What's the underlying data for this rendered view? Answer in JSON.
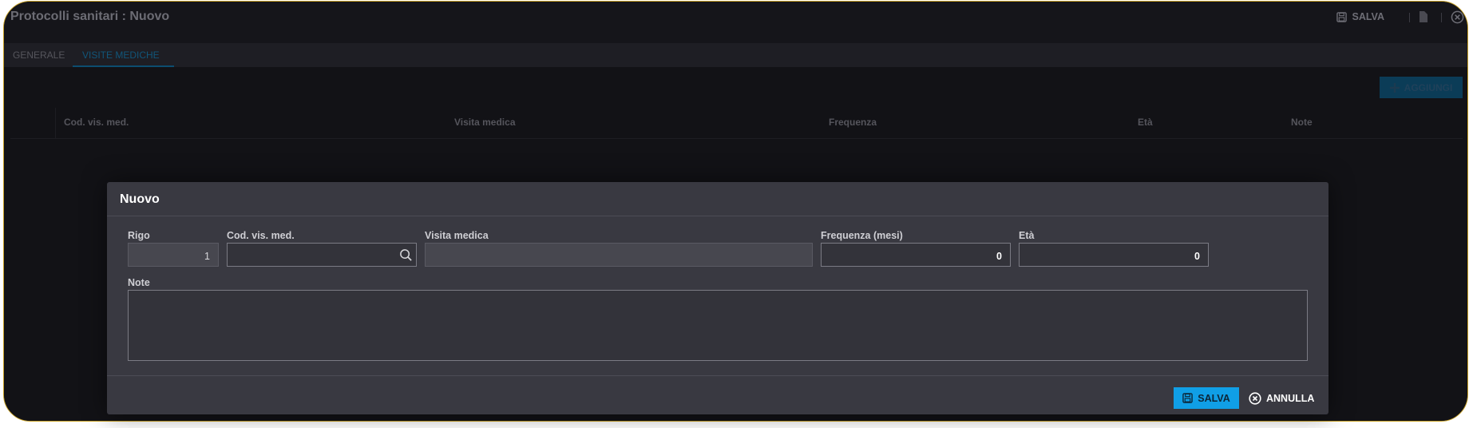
{
  "window": {
    "title": "Protocolli sanitari : Nuovo",
    "toolbar": {
      "save_label": "SALVA"
    }
  },
  "tabs": [
    {
      "label": "GENERALE",
      "active": false
    },
    {
      "label": "VISITE MEDICHE",
      "active": true
    }
  ],
  "grid": {
    "add_label": "AGGIUNGI",
    "columns": [
      "Cod. vis. med.",
      "Visita medica",
      "Frequenza",
      "Età",
      "Note"
    ]
  },
  "dialog": {
    "title": "Nuovo",
    "fields": {
      "rigo": {
        "label": "Rigo",
        "value": "1"
      },
      "cod": {
        "label": "Cod. vis. med.",
        "value": ""
      },
      "visita": {
        "label": "Visita medica",
        "value": ""
      },
      "frequenza": {
        "label": "Frequenza (mesi)",
        "value": "0"
      },
      "eta": {
        "label": "Età",
        "value": "0"
      },
      "note": {
        "label": "Note",
        "value": ""
      }
    },
    "save_label": "SALVA",
    "cancel_label": "ANNULLA"
  },
  "colors": {
    "accent": "#109fe6",
    "window_border": "#c9a227",
    "dialog_bg": "#393941"
  },
  "icons": [
    "save-icon",
    "close-circle-icon",
    "plus-icon",
    "search-icon",
    "cancel-icon"
  ]
}
